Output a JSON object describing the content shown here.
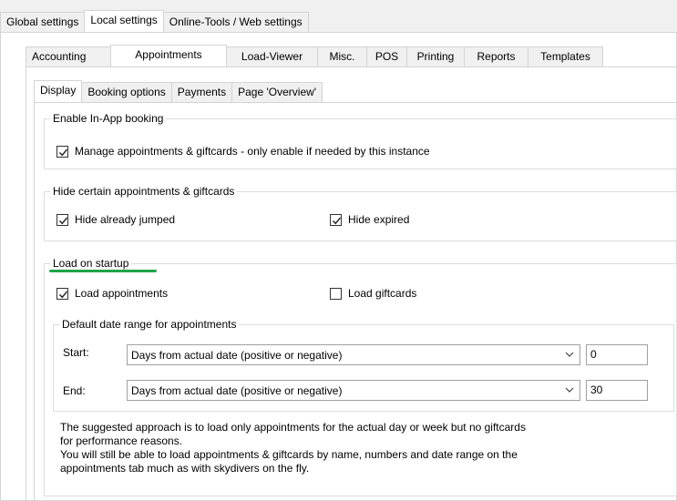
{
  "top_tabs": [
    "Global settings",
    "Local settings",
    "Online-Tools / Web settings"
  ],
  "top_active": 1,
  "second_tabs": [
    "Accounting",
    "Appointments",
    "Load-Viewer",
    "Misc.",
    "POS",
    "Printing",
    "Reports",
    "Templates"
  ],
  "second_active": 1,
  "third_tabs": [
    "Display",
    "Booking options",
    "Payments",
    "Page 'Overview'"
  ],
  "third_active": 0,
  "inapp": {
    "legend": "Enable In-App booking",
    "manage_label": "Manage appointments & giftcards - only enable if needed by this instance",
    "manage_checked": true
  },
  "hide": {
    "legend": "Hide certain appointments & giftcards",
    "jumped_label": "Hide already jumped",
    "jumped_checked": true,
    "expired_label": "Hide expired",
    "expired_checked": true
  },
  "startup": {
    "legend": "Load on startup",
    "appointments_label": "Load appointments",
    "appointments_checked": true,
    "giftcards_label": "Load giftcards",
    "giftcards_checked": false
  },
  "daterange": {
    "legend": "Default date range for appointments",
    "start_label": "Start:",
    "start_value": "Days from actual date (positive or negative)",
    "start_days": "0",
    "end_label": "End:",
    "end_value": "Days from actual date (positive or negative)",
    "end_days": "30"
  },
  "note": {
    "line1": "The suggested approach is to load only appointments for the actual day or week but no giftcards",
    "line2": "for performance reasons.",
    "line3": "You will still be able to load appointments & giftcards by name, numbers and date range on the",
    "line4": "appointments tab much as with skydivers on the fly."
  },
  "accent_color": "#1ea34a"
}
